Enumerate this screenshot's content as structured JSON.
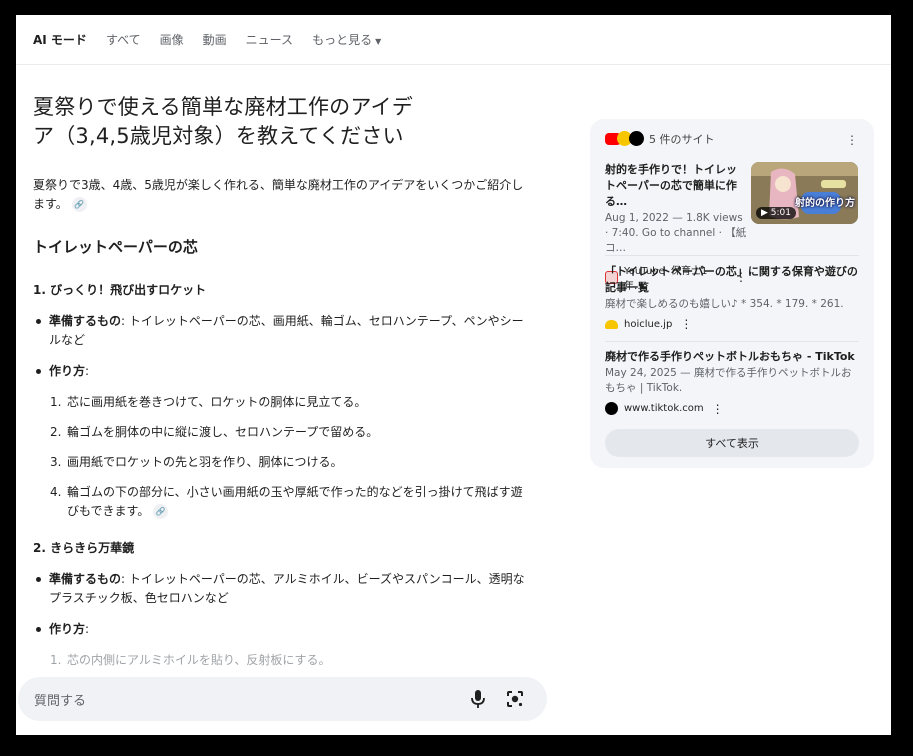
{
  "nav": {
    "tabs": [
      {
        "label": "AI モード"
      },
      {
        "label": "すべて"
      },
      {
        "label": "画像"
      },
      {
        "label": "動画"
      },
      {
        "label": "ニュース"
      },
      {
        "label": "もっと見る"
      }
    ],
    "active_tab": "AI モード"
  },
  "query": {
    "line1": "夏祭りで使える簡単な廃材工作のアイデ",
    "line2": "ア（3,4,5歳児対象）を教えてください"
  },
  "answer": {
    "intro": "夏祭りで3歳、4歳、5歳児が楽しく作れる、簡単な廃材工作のアイデアをいくつかご紹介します。",
    "section_title": "トイレットペーパーの芯",
    "idea1": {
      "title": "1. びっくり！飛び出すロケット",
      "materials_label": "準備するもの",
      "materials": ": トイレットペーパーの芯、画用紙、輪ゴム、セロハンテープ、ペンやシールなど",
      "howto_label": "作り方",
      "howto_suffix": ":",
      "steps": [
        {
          "num": "1.",
          "text": "芯に画用紙を巻きつけて、ロケットの胴体に見立てる。"
        },
        {
          "num": "2.",
          "text": "輪ゴムを胴体の中に縦に渡し、セロハンテープで留める。"
        },
        {
          "num": "3.",
          "text": "画用紙でロケットの先と羽を作り、胴体につける。"
        },
        {
          "num": "4.",
          "text": "輪ゴムの下の部分に、小さい画用紙の玉や厚紙で作った的などを引っ掛けて飛ばす遊びもできます。"
        }
      ]
    },
    "idea2": {
      "title": "2. きらきら万華鏡",
      "materials_label": "準備するもの",
      "materials": ": トイレットペーパーの芯、アルミホイル、ビーズやスパンコール、透明なプラスチック板、色セロハンなど",
      "howto_label": "作り方",
      "howto_suffix": ":",
      "steps": [
        {
          "num": "1.",
          "text": "芯の内側にアルミホイルを貼り、反射板にする。"
        }
      ]
    }
  },
  "ask_bar": {
    "placeholder": "質問する"
  },
  "sources": {
    "count_label": "5 件のサイト",
    "items": [
      {
        "title": "射的を手作りで！トイレットペーパーの芯で簡単に作る…",
        "snippet": "Aug 1, 2022 — 1.8K views · 7:40. Go to channel · 【紙コ…",
        "source": "YouTube· 保育士1年…",
        "thumb_text": "射的の作り方",
        "duration": "5:01"
      },
      {
        "title": "「トイレットペーパーの芯」に関する保育や遊びの記事一覧",
        "snippet": "廃材で楽しめるのも嬉しい♪ * 354. * 179. * 261.",
        "source": "hoiclue.jp"
      },
      {
        "title": "廃材で作る手作りペットボトルおもちゃ - TikTok",
        "snippet": "May 24, 2025 — 廃材で作る手作りペットボトルおもちゃ | TikTok.",
        "source": "www.tiktok.com"
      }
    ],
    "show_all": "すべて表示"
  },
  "colors": {
    "youtube_red": "#ff0000",
    "hoiclue_yellow": "#f7c600",
    "tiktok_black": "#000000",
    "sidebar_bg": "#f3f5f8"
  }
}
